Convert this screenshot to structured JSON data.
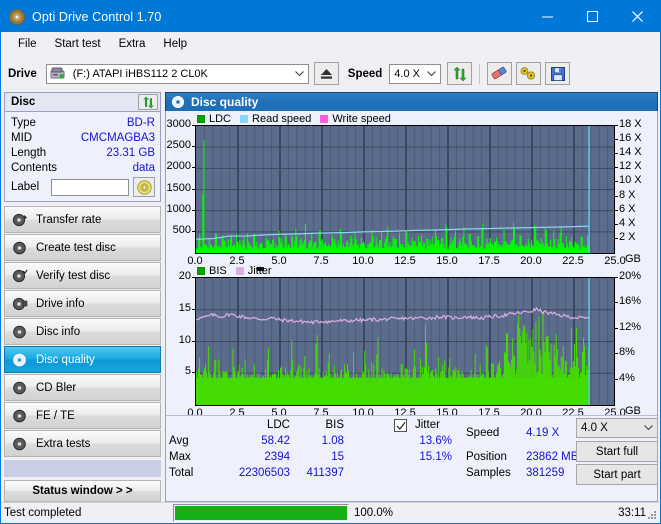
{
  "window": {
    "title": "Opti Drive Control 1.70",
    "minimize": "–",
    "maximize": "□",
    "close": "✕"
  },
  "menu": [
    "File",
    "Start test",
    "Extra",
    "Help"
  ],
  "toolbar": {
    "drive_label": "Drive",
    "drive_value": "(F:)  ATAPI iHBS112  2 CL0K",
    "eject_icon": "eject-icon",
    "speed_label": "Speed",
    "speed_value": "4.0 X",
    "refresh_icon": "refresh-icon",
    "erase_icon": "eraser-icon",
    "tools_icon": "tools-icon",
    "save_icon": "save-icon"
  },
  "disc_panel": {
    "title": "Disc",
    "refresh_icon": "refresh-icon",
    "rows": [
      {
        "key": "Type",
        "value": "BD-R"
      },
      {
        "key": "MID",
        "value": "CMCMAGBA3"
      },
      {
        "key": "Length",
        "value": "23.31 GB"
      },
      {
        "key": "Contents",
        "value": "data"
      }
    ],
    "label_key": "Label",
    "label_value": "",
    "disc_icon": "disc-icon"
  },
  "nav": {
    "items": [
      {
        "label": "Transfer rate",
        "icon": "disc-arrow-icon",
        "active": false
      },
      {
        "label": "Create test disc",
        "icon": "disc-write-icon",
        "active": false
      },
      {
        "label": "Verify test disc",
        "icon": "disc-check-icon",
        "active": false
      },
      {
        "label": "Drive info",
        "icon": "disc-info-icon",
        "active": false
      },
      {
        "label": "Disc info",
        "icon": "disc-info2-icon",
        "active": false
      },
      {
        "label": "Disc quality",
        "icon": "disc-quality-icon",
        "active": true
      },
      {
        "label": "CD Bler",
        "icon": "disc-bler-icon",
        "active": false
      },
      {
        "label": "FE / TE",
        "icon": "disc-fete-icon",
        "active": false
      },
      {
        "label": "Extra tests",
        "icon": "disc-extra-icon",
        "active": false
      }
    ],
    "status_window": "Status window > >"
  },
  "main": {
    "title": "Disc quality",
    "icon": "disc-quality-icon"
  },
  "stats": {
    "col_ldc": "LDC",
    "col_bis": "BIS",
    "row_avg": "Avg",
    "row_max": "Max",
    "row_total": "Total",
    "ldc_avg": "58.42",
    "ldc_max": "2394",
    "ldc_total": "22306503",
    "bis_avg": "1.08",
    "bis_max": "15",
    "bis_total": "411397",
    "jitter_label": "Jitter",
    "jitter_checked": true,
    "jitter_avg": "13.6%",
    "jitter_max": "15.1%",
    "speed_label": "Speed",
    "speed_value": "4.19 X",
    "position_label": "Position",
    "position_value": "23862 MB",
    "samples_label": "Samples",
    "samples_value": "381259",
    "speed_select": "4.0 X",
    "start_full": "Start full",
    "start_part": "Start part"
  },
  "statusbar": {
    "message": "Test completed",
    "progress_percent": "100.0%",
    "progress_value": 100,
    "elapsed": "33:11"
  },
  "colors": {
    "accent": "#0078d7",
    "ldc_green": "#00a000",
    "bis_green": "#00a000",
    "read_speed": "#8ad8f5",
    "write_speed": "#ff5ce0",
    "jitter": "#d9aee0",
    "plot_bg": "#5c6c8c",
    "value_blue": "#1414d2",
    "progress_green": "#15b215"
  },
  "chart_data": [
    {
      "type": "area",
      "name": "disc-quality-ldc-chart",
      "title": "",
      "xlabel": "GB",
      "ylabel": "",
      "xlim": [
        0,
        25
      ],
      "ylim": [
        0,
        3000
      ],
      "y2lim": [
        0,
        18
      ],
      "y2label": "X",
      "xticks": [
        "0.0",
        "2.5",
        "5.0",
        "7.5",
        "10.0",
        "12.5",
        "15.0",
        "17.5",
        "20.0",
        "22.5",
        "25.0"
      ],
      "yticks": [
        "3000",
        "2500",
        "2000",
        "1500",
        "1000",
        "500"
      ],
      "y2ticks": [
        "18 X",
        "16 X",
        "14 X",
        "12 X",
        "10 X",
        "8 X",
        "6 X",
        "4 X",
        "2 X"
      ],
      "grid": true,
      "legend": [
        {
          "label": "LDC",
          "color": "#00a000"
        },
        {
          "label": "Read speed",
          "color": "#8ad8f5"
        },
        {
          "label": "Write speed",
          "color": "#ff5ce0"
        }
      ],
      "data_end_gb": 23.4,
      "series": [
        {
          "name": "LDC",
          "color": "#00ff00",
          "kind": "spikes",
          "baseline": 90,
          "peak_max": 2394,
          "avg": 58.42,
          "values": [
            120,
            380,
            140,
            2394,
            200,
            160,
            330,
            240,
            170,
            420,
            210,
            180,
            560,
            260,
            190,
            300,
            620,
            230,
            170,
            450,
            280,
            200,
            350,
            190,
            520,
            240,
            170,
            610,
            230,
            200,
            380,
            260,
            180,
            470,
            300,
            210,
            340,
            250,
            190,
            560,
            280,
            200,
            420,
            230,
            170,
            390,
            260,
            480,
            200,
            330,
            250,
            600,
            190,
            280,
            420,
            230,
            350,
            190,
            510,
            270,
            200,
            380,
            240,
            180,
            450,
            290,
            210,
            340,
            600,
            230,
            190,
            420,
            270,
            350,
            200,
            480,
            240,
            190,
            520,
            300,
            210,
            380,
            250,
            560,
            200,
            330,
            270,
            430,
            190,
            280,
            620,
            240,
            200,
            390,
            350,
            210,
            470,
            260,
            180,
            540,
            290,
            220,
            400,
            250,
            190,
            360,
            580,
            230,
            200,
            450,
            270,
            330,
            190,
            510,
            280,
            210,
            390,
            240,
            600,
            200,
            340,
            260,
            470,
            190,
            300,
            250,
            560,
            220,
            180,
            420,
            280,
            350,
            200,
            480,
            240,
            620,
            190,
            330,
            270,
            400,
            210,
            290,
            530,
            230,
            180,
            450,
            260,
            340,
            200,
            380,
            600,
            240,
            190,
            420,
            270,
            310,
            200,
            490,
            250,
            180,
            560,
            290,
            220,
            370,
            240,
            640,
            190,
            330,
            260,
            440,
            210,
            280,
            510,
            230,
            190,
            400,
            270,
            350,
            200,
            470,
            240,
            180,
            590,
            300,
            220,
            380
          ]
        },
        {
          "name": "Read speed",
          "color": "#8ad8f5",
          "kind": "line",
          "start_x": 1.9,
          "end_x": 23.4,
          "unit": "X",
          "points": [
            [
              0.0,
              1.95
            ],
            [
              1.0,
              2.05
            ],
            [
              2.0,
              2.4
            ],
            [
              3.0,
              2.4
            ],
            [
              4.0,
              2.55
            ],
            [
              5.0,
              2.65
            ],
            [
              6.0,
              2.7
            ],
            [
              7.0,
              2.8
            ],
            [
              8.0,
              2.85
            ],
            [
              9.0,
              2.9
            ],
            [
              10.0,
              3.0
            ],
            [
              11.0,
              3.05
            ],
            [
              12.0,
              3.1
            ],
            [
              13.0,
              3.2
            ],
            [
              14.0,
              3.25
            ],
            [
              15.0,
              3.3
            ],
            [
              16.0,
              3.4
            ],
            [
              17.0,
              3.45
            ],
            [
              18.0,
              3.5
            ],
            [
              19.0,
              3.55
            ],
            [
              20.0,
              3.6
            ],
            [
              21.0,
              3.65
            ],
            [
              22.0,
              3.7
            ],
            [
              23.0,
              3.78
            ],
            [
              23.4,
              3.8
            ]
          ]
        }
      ],
      "cursor_x_gb": 23.4
    },
    {
      "type": "area",
      "name": "disc-quality-bis-chart",
      "title": "",
      "xlabel": "GB",
      "ylabel": "",
      "xlim": [
        0,
        25
      ],
      "ylim": [
        0,
        20
      ],
      "y2lim": [
        0,
        20
      ],
      "y2label": "%",
      "xticks": [
        "0.0",
        "2.5",
        "5.0",
        "7.5",
        "10.0",
        "12.5",
        "15.0",
        "17.5",
        "20.0",
        "22.5",
        "25.0"
      ],
      "yticks": [
        "20",
        "15",
        "10",
        "5"
      ],
      "y2ticks": [
        "20%",
        "16%",
        "12%",
        "8%",
        "4%"
      ],
      "grid": true,
      "legend": [
        {
          "label": "BIS",
          "color": "#00a000"
        },
        {
          "label": "Jitter",
          "color": "#d9aee0"
        }
      ],
      "data_end_gb": 23.4,
      "series": [
        {
          "name": "BIS",
          "color": "#44dd00",
          "kind": "spikes",
          "baseline": 4.3,
          "peak_max": 15,
          "avg": 1.08,
          "values": [
            5.5,
            6.2,
            5.0,
            4.8,
            6.0,
            5.2,
            8.8,
            5.4,
            4.9,
            6.5,
            5.1,
            7.2,
            5.3,
            4.7,
            6.8,
            5.0,
            5.6,
            4.9,
            7.5,
            5.2,
            4.8,
            6.0,
            5.4,
            5.0,
            8.0,
            5.1,
            4.6,
            6.4,
            5.5,
            5.0,
            7.8,
            5.2,
            4.9,
            6.1,
            5.3,
            8.2,
            4.8,
            5.6,
            6.0,
            5.1,
            4.7,
            7.0,
            5.4,
            5.0,
            6.3,
            4.9,
            5.2,
            8.5,
            5.0,
            4.8,
            6.6,
            5.3,
            5.1,
            7.3,
            4.9,
            5.5,
            6.0,
            5.2,
            4.7,
            9.2,
            5.4,
            5.0,
            6.2,
            4.8,
            5.6,
            7.1,
            5.1,
            4.9,
            6.5,
            5.3,
            5.0,
            8.1,
            4.8,
            5.4,
            6.0,
            5.2,
            4.9,
            7.4,
            5.1,
            5.5,
            6.3,
            4.7,
            5.2,
            8.8,
            5.0,
            4.9,
            6.1,
            5.3,
            5.1,
            9.0,
            4.8,
            5.4,
            6.4,
            5.0,
            5.2,
            7.2,
            4.9,
            5.6,
            6.0,
            5.1,
            4.8,
            8.3,
            5.3,
            5.0,
            6.2,
            4.9,
            5.4,
            7.6,
            5.1,
            4.7,
            6.5,
            5.2,
            5.0,
            12.2,
            5.5,
            4.9,
            6.0,
            5.3,
            5.1,
            8.0,
            4.8,
            5.4,
            6.3,
            5.0,
            5.2,
            7.0,
            4.9,
            5.5,
            6.1,
            5.1,
            4.8,
            9.5,
            5.3,
            5.0,
            6.4,
            4.9,
            5.6,
            7.8,
            5.2,
            5.0,
            6.0,
            5.4,
            4.8,
            10.5,
            5.1,
            5.5,
            6.2,
            5.0,
            5.3,
            8.6,
            4.9,
            5.2,
            9.8,
            11.5,
            10.2,
            12.5,
            9.6,
            11.0,
            10.8,
            13.5,
            9.2,
            11.8,
            10.4,
            12.0,
            9.8,
            11.2,
            10.6,
            13.8,
            9.4,
            11.6,
            10.0,
            12.8,
            9.0,
            10.5,
            11.4,
            9.6,
            8.8,
            10.2,
            9.4,
            11.0,
            8.6,
            9.8,
            10.6,
            8.2,
            9.0,
            11.2,
            8.4,
            12.4,
            7.8,
            9.2,
            8.6,
            10.0,
            7.6,
            8.8
          ]
        },
        {
          "name": "Jitter",
          "color": "#d9aee0",
          "kind": "line",
          "unit": "%",
          "avg": 13.6,
          "max": 15.1,
          "points": [
            [
              0.0,
              13.6
            ],
            [
              0.5,
              13.8
            ],
            [
              1.0,
              14.2
            ],
            [
              1.5,
              13.9
            ],
            [
              2.0,
              14.3
            ],
            [
              2.5,
              14.0
            ],
            [
              3.0,
              13.8
            ],
            [
              3.5,
              13.6
            ],
            [
              4.0,
              13.5
            ],
            [
              4.5,
              13.7
            ],
            [
              5.0,
              13.4
            ],
            [
              5.5,
              13.3
            ],
            [
              6.0,
              13.2
            ],
            [
              6.5,
              13.1
            ],
            [
              7.0,
              13.0
            ],
            [
              7.5,
              13.2
            ],
            [
              8.0,
              13.1
            ],
            [
              8.5,
              13.3
            ],
            [
              9.0,
              13.2
            ],
            [
              9.5,
              13.4
            ],
            [
              10.0,
              13.3
            ],
            [
              10.5,
              13.5
            ],
            [
              11.0,
              13.4
            ],
            [
              11.5,
              13.6
            ],
            [
              12.0,
              13.5
            ],
            [
              12.5,
              13.7
            ],
            [
              13.0,
              13.6
            ],
            [
              13.5,
              13.8
            ],
            [
              14.0,
              13.7
            ],
            [
              14.5,
              13.9
            ],
            [
              15.0,
              13.8
            ],
            [
              15.5,
              13.7
            ],
            [
              16.0,
              13.9
            ],
            [
              16.5,
              13.8
            ],
            [
              17.0,
              13.7
            ],
            [
              17.5,
              13.9
            ],
            [
              18.0,
              14.0
            ],
            [
              18.5,
              14.2
            ],
            [
              19.0,
              14.4
            ],
            [
              19.5,
              14.6
            ],
            [
              20.0,
              14.8
            ],
            [
              20.3,
              15.1
            ],
            [
              20.6,
              14.7
            ],
            [
              21.0,
              14.5
            ],
            [
              21.5,
              14.2
            ],
            [
              22.0,
              14.0
            ],
            [
              22.5,
              13.8
            ],
            [
              23.0,
              13.7
            ],
            [
              23.4,
              13.6
            ]
          ]
        }
      ],
      "cursor_x_gb": 23.4
    }
  ]
}
